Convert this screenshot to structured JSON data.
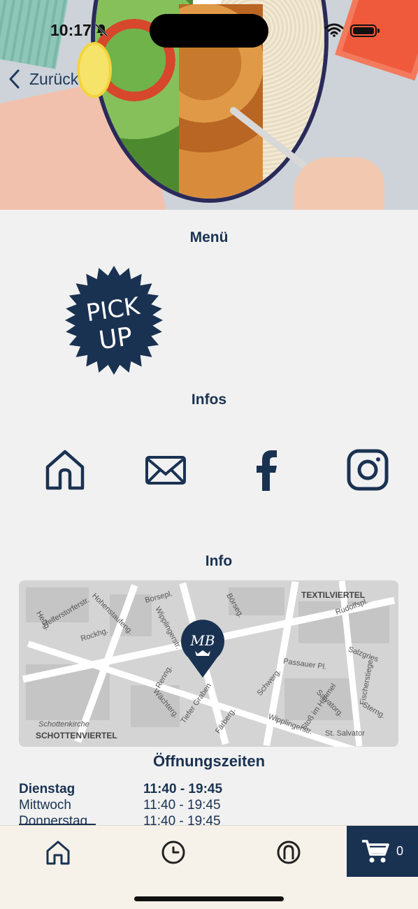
{
  "status": {
    "time": "10:17"
  },
  "nav": {
    "back_label": "Zurück"
  },
  "sections": {
    "menu_title": "Menü",
    "infos_title": "Infos",
    "info_title": "Info",
    "hours_title": "Öffnungszeiten"
  },
  "pickup_badge": {
    "line1": "PICK",
    "line2": "UP"
  },
  "info_icons": [
    "home-icon",
    "mail-icon",
    "facebook-icon",
    "instagram-icon"
  ],
  "map": {
    "labels": [
      "TEXTILVIERTEL",
      "Rudolfspl.",
      "Hohenstaufeng.",
      "Helferstorferstr.",
      "Rockhg.",
      "Heßg.",
      "Borsepl.",
      "Börseg.",
      "Wipplingerstr.",
      "Salzgries",
      "Passauer Pl.",
      "Renng.",
      "Schwerg.",
      "Tiefer Graben",
      "Färberg.",
      "Wächterg.",
      "Stoß im Himmel",
      "Salvatorg.",
      "Fischerstiege",
      "Sterng.",
      "Wipplingerstr.",
      "Schottenkirche",
      "SCHOTTENVIERTEL",
      "St. Salvator"
    ],
    "pin_logo": "MB"
  },
  "hours": [
    {
      "day": "Dienstag",
      "time": "11:40 - 19:45",
      "today": true
    },
    {
      "day": "Mittwoch",
      "time": "11:40 - 19:45",
      "today": false
    },
    {
      "day": "Donnerstag",
      "time": "11:40 - 19:45",
      "today": false
    }
  ],
  "tabbar": {
    "tabs": [
      "home-icon",
      "clock-icon",
      "profile-icon"
    ],
    "cart_count": "0"
  },
  "colors": {
    "primary": "#1a3252",
    "background": "#f1f1f1",
    "tabbar": "#f7f2e9"
  }
}
